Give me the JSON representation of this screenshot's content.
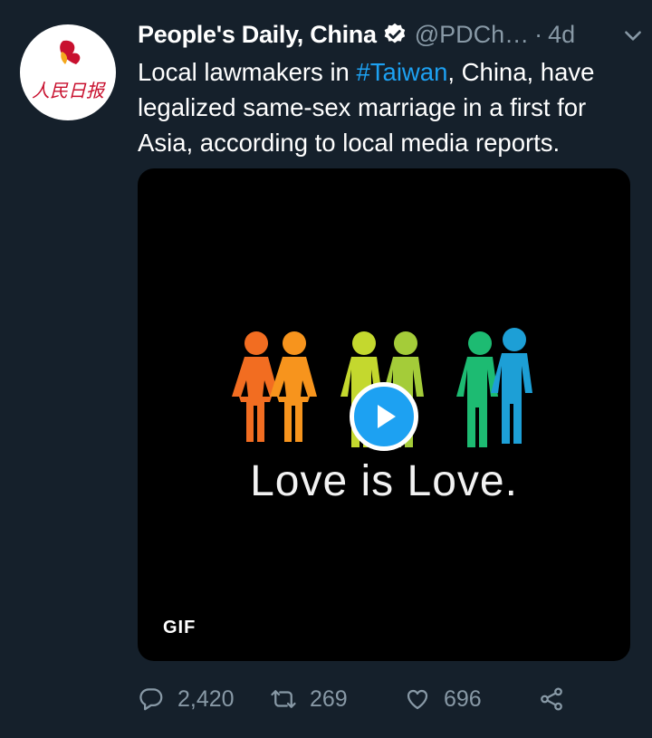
{
  "tweet": {
    "author_name": "People's Daily, China",
    "handle": "@PDCh…",
    "separator": "·",
    "time": "4d",
    "text_before": "Local lawmakers in ",
    "hashtag": "#Taiwan",
    "text_after": ", China, have legalized same-sex marriage in a first for Asia, according to local media reports."
  },
  "avatar": {
    "logo_text": "人民日报"
  },
  "media": {
    "caption": "Love is Love.",
    "badge": "GIF",
    "figure_colors": [
      "#f26d21",
      "#f7941d",
      "#c4d82e",
      "#a4cc39",
      "#1dbb72",
      "#1d9fd6"
    ]
  },
  "actions": {
    "replies": "2,420",
    "retweets": "269",
    "likes": "696"
  },
  "icons": [
    "verified-badge-icon",
    "chevron-down-icon",
    "play-icon",
    "reply-icon",
    "retweet-icon",
    "like-icon",
    "share-icon"
  ],
  "colors": {
    "background": "#15202b",
    "link": "#1da1f2",
    "muted": "#8899a6"
  }
}
